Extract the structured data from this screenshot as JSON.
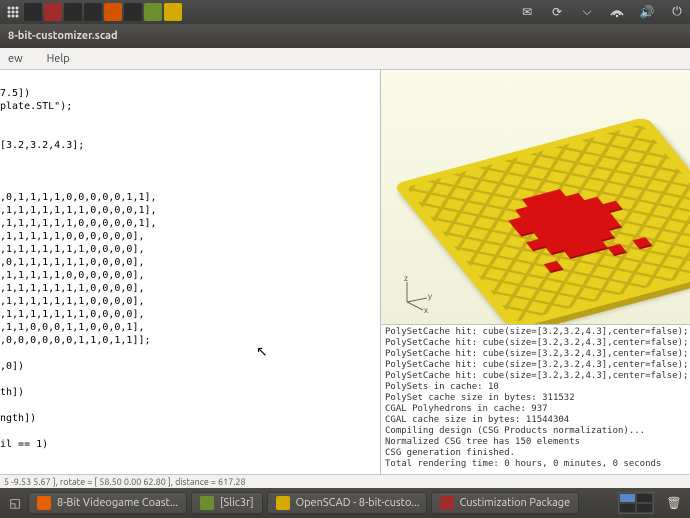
{
  "panel": {
    "right_icons": [
      "mail-icon",
      "updates-icon",
      "bluetooth-icon",
      "network-icon",
      "volume-icon",
      "power-icon"
    ]
  },
  "window": {
    "title": "8-bit-customizer.scad"
  },
  "menu": {
    "items": [
      "ew",
      "Help"
    ]
  },
  "code": {
    "lines": [
      "",
      "7.5])",
      "plate.STL\");",
      "",
      "",
      "[3.2,3.2,4.3];",
      "",
      "",
      "",
      ",0,1,1,1,1,0,0,0,0,0,1,1],",
      ",1,1,1,1,1,1,1,0,0,0,0,1],",
      ",1,1,1,1,1,1,0,0,0,0,0,1],",
      ",1,1,1,1,1,0,0,0,0,0,0],",
      ",1,1,1,1,1,1,1,0,0,0,0],",
      ",0,1,1,1,1,1,1,0,0,0,0],",
      ",1,1,1,1,1,0,0,0,0,0,0],",
      ",1,1,1,1,1,1,1,0,0,0,0],",
      ",1,1,1,1,1,1,1,0,0,0,0],",
      ",1,1,1,1,1,1,1,0,0,0,0],",
      ",1,1,0,0,0,1,1,0,0,0,1],",
      ",0,0,0,0,0,0,1,1,0,1,1]];",
      "",
      ",0])",
      "",
      "th])",
      "",
      "ngth])",
      "",
      "il == 1)"
    ]
  },
  "console": {
    "lines": [
      "PolySetCache hit: cube(size=[3.2,3.2,4.3],center=false);",
      "PolySetCache hit: cube(size=[3.2,3.2,4.3],center=false);",
      "PolySetCache hit: cube(size=[3.2,3.2,4.3],center=false);",
      "PolySetCache hit: cube(size=[3.2,3.2,4.3],center=false);",
      "PolySetCache hit: cube(size=[3.2,3.2,4.3],center=false);",
      "PolySets in cache: 10",
      "PolySet cache size in bytes: 311532",
      "CGAL Polyhedrons in cache: 937",
      "CGAL cache size in bytes: 11544304",
      "Compiling design (CSG Products normalization)...",
      "Normalized CSG tree has 150 elements",
      "CSG generation finished.",
      "Total rendering time: 0 hours, 0 minutes, 0 seconds"
    ]
  },
  "axes": {
    "x": "x",
    "y": "y",
    "z": "z"
  },
  "status": {
    "text": "5 -9.53 5.67 ], rotate = [ 58.50 0.00 62.80 ], distance = 617.28"
  },
  "taskbar": {
    "items": [
      {
        "label": "8-Bit Videogame Coast...",
        "icon": "ff"
      },
      {
        "label": "[Slic3r]",
        "icon": "sl"
      },
      {
        "label": "OpenSCAD - 8-bit-custo...",
        "icon": "sc"
      },
      {
        "label": "Custimization Package",
        "icon": "pk"
      }
    ]
  }
}
